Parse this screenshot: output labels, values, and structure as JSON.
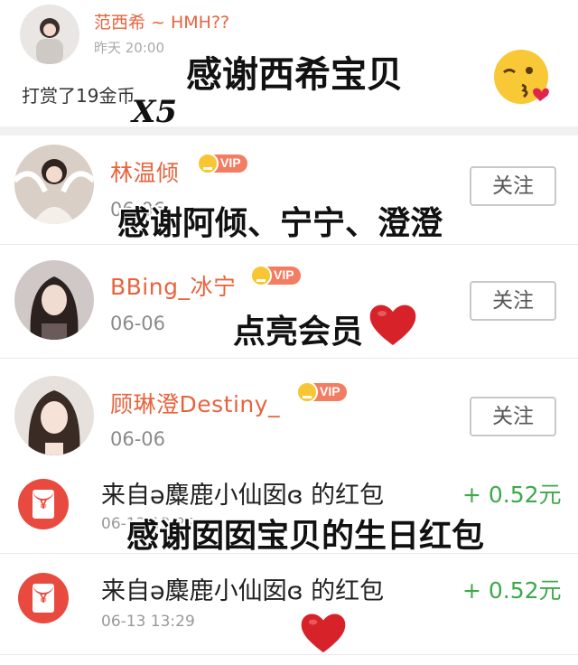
{
  "reward_item": {
    "user_name": "范西希 ~ HMH??",
    "time": "昨天 20:00",
    "message": "打赏了19金币"
  },
  "follow_list": [
    {
      "name": "林温倾",
      "badge": "VIP",
      "date": "06-06",
      "follow_label": "关注"
    },
    {
      "name": "BBing_冰宁",
      "badge": "VIP",
      "date": "06-06",
      "follow_label": "关注"
    },
    {
      "name": "顾琳澄Destiny_",
      "badge": "VIP",
      "date": "06-06",
      "follow_label": "关注"
    }
  ],
  "red_packets": [
    {
      "title": "来自ə麋鹿小仙囡ɞ 的红包",
      "amount": "+ 0.52元",
      "time": "06-13 13:29",
      "icon": "red-envelope-icon"
    },
    {
      "title": "来自ə麋鹿小仙囡ɞ 的红包",
      "amount": "+ 0.52元",
      "time": "06-13 13:29",
      "icon": "red-envelope-icon"
    }
  ],
  "overlays": {
    "thanks_xixi": "感谢西希宝贝",
    "times_five": "X5",
    "thanks_three": "感谢阿倾、宁宁、澄澄",
    "light_vip": "点亮会员",
    "thanks_birthday": "感谢囡囡宝贝的生日红包"
  },
  "colors": {
    "name_orange": "#e8633d",
    "amount_green": "#3fa84b",
    "envelope_red": "#e84a3f",
    "vip_gold": "#f7c632",
    "heart_red": "#d8222a"
  }
}
